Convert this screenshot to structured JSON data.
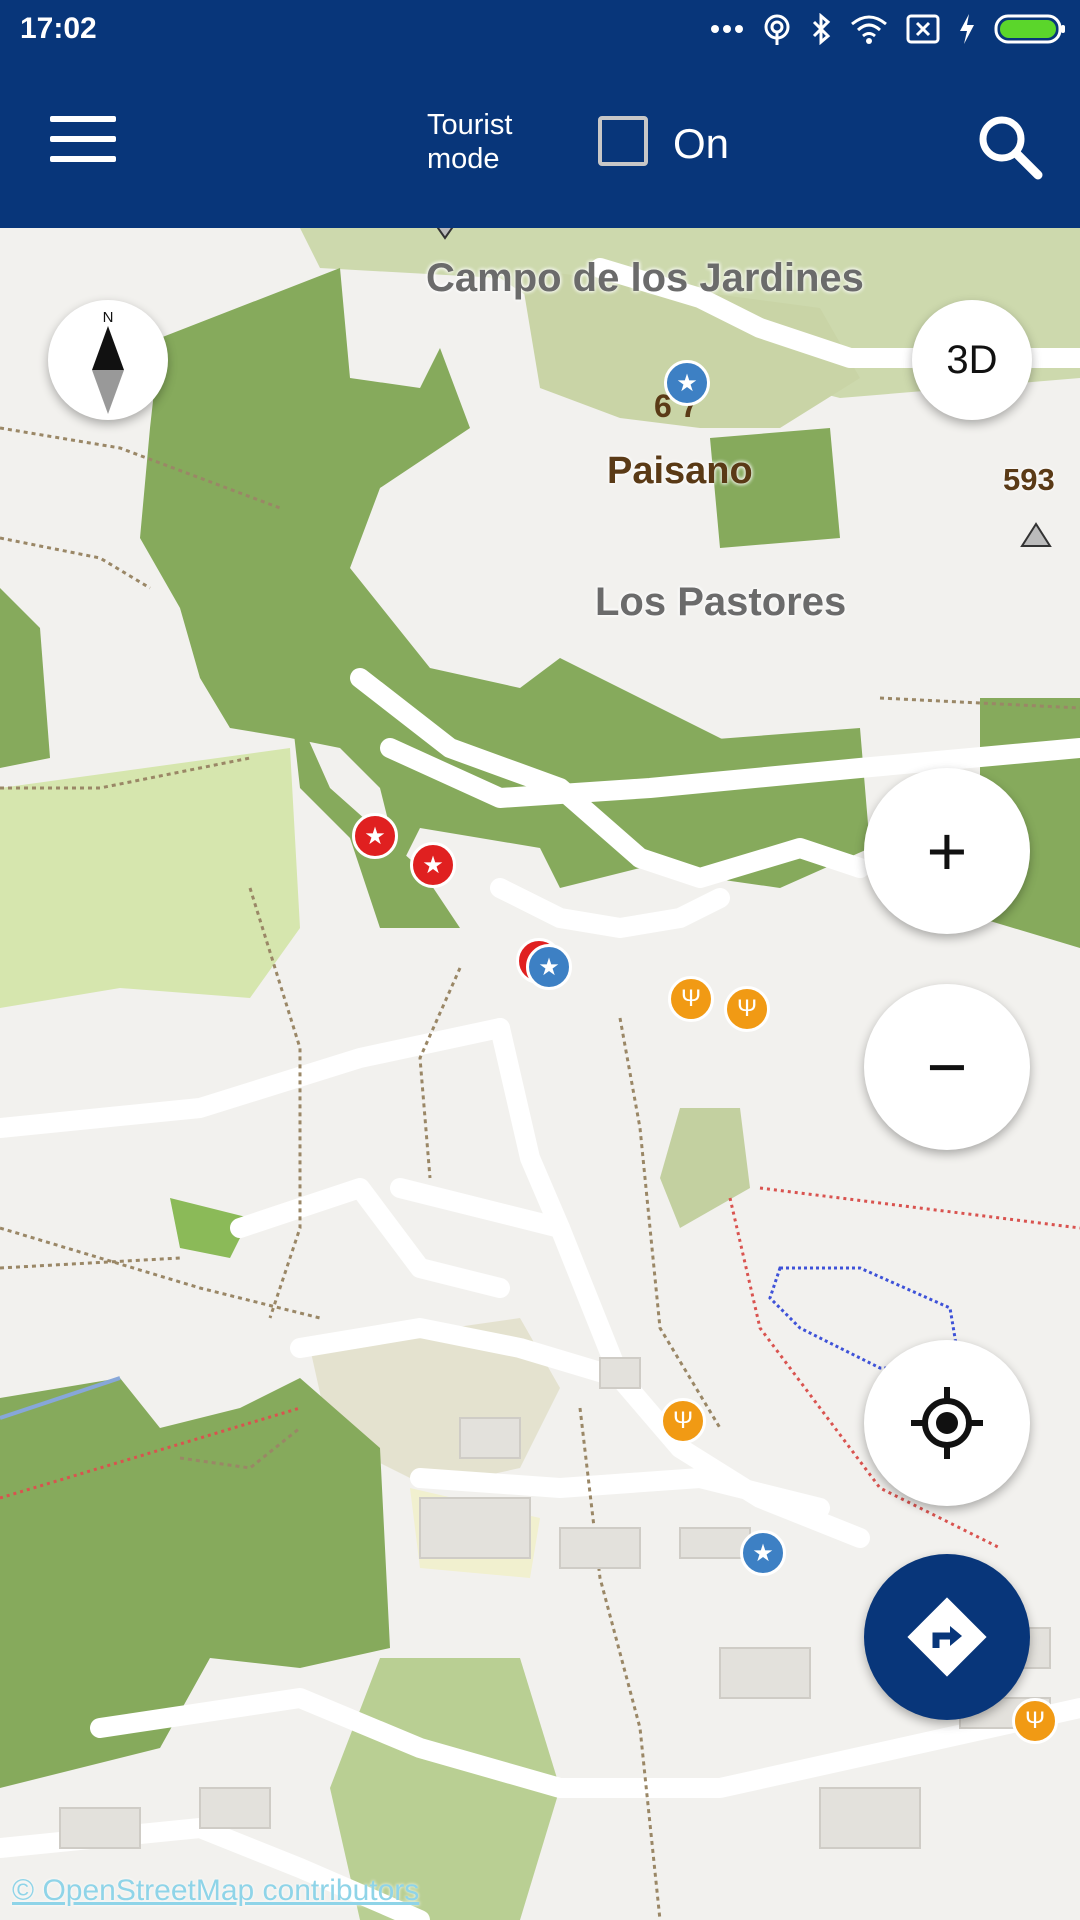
{
  "status_bar": {
    "time": "17:02",
    "icons": [
      "more-dots-icon",
      "hotspot-icon",
      "bluetooth-icon",
      "wifi-icon",
      "sim-x-icon",
      "charging-icon",
      "battery-icon"
    ]
  },
  "app_bar": {
    "menu_icon": "hamburger-icon",
    "tourist_mode_label": "Tourist\nmode",
    "tourist_mode_checked": false,
    "on_label": "On",
    "search_icon": "search-icon"
  },
  "map": {
    "labels": {
      "campo": "Campo de los Jardines",
      "paisano": "Paisano",
      "pastores": "Los Pastores",
      "elevation": "593",
      "peak_partial": "6 7"
    },
    "controls": {
      "compass_north": "N",
      "threed": "3D",
      "zoom_in": "+",
      "zoom_out": "−"
    },
    "attribution": "© OpenStreetMap contributors",
    "colors": {
      "header": "#08367a",
      "forest": "#86aa5c",
      "scrub": "#c8d5a6",
      "meadow": "#d7e6b0",
      "road": "#ffffff",
      "path": "#9a8766",
      "poi_red": "#e02020",
      "poi_blue": "#3d80c4",
      "poi_orange": "#f19a14"
    }
  }
}
